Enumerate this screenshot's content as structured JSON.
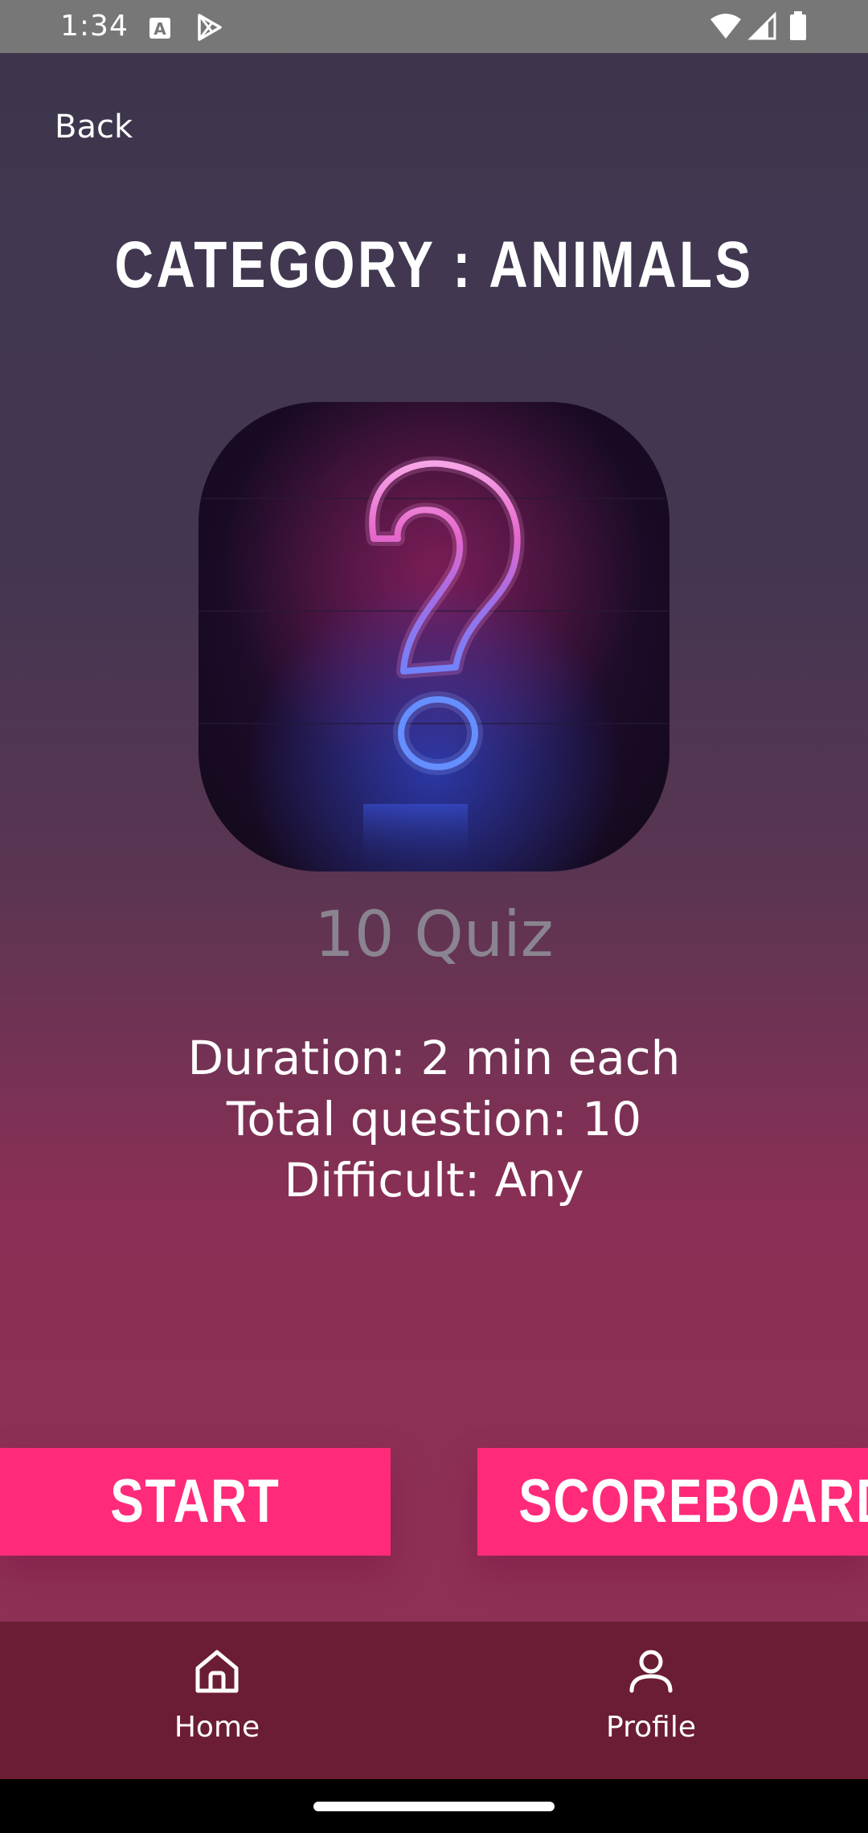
{
  "status_bar": {
    "time": "1:34",
    "icons": [
      "text-notification-icon",
      "play-store-icon",
      "wifi-icon",
      "cellular-signal-icon",
      "battery-icon"
    ]
  },
  "header": {
    "back_label": "Back"
  },
  "category": {
    "title": "CATEGORY : ANIMALS"
  },
  "quiz": {
    "image_icon": "question-mark-neon-icon",
    "count_label": "10 Quiz",
    "details": {
      "duration": "Duration: 2 min each",
      "total_questions": "Total question: 10",
      "difficulty": "Difficult: Any"
    }
  },
  "actions": {
    "start_label": "START",
    "scoreboard_label": "SCOREBOARD"
  },
  "bottom_nav": {
    "items": [
      {
        "label": "Home",
        "icon": "home-icon"
      },
      {
        "label": "Profile",
        "icon": "profile-icon"
      }
    ]
  },
  "colors": {
    "accent": "#ff2b7a",
    "nav_background": "#6b1d34",
    "status_bar": "#777777"
  }
}
